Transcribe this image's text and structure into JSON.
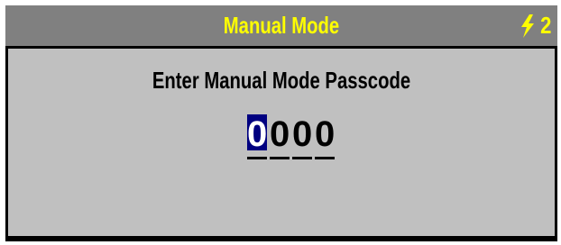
{
  "header": {
    "title": "Manual Mode",
    "status_icon": "lightning-bolt-icon",
    "status_value": "2"
  },
  "main": {
    "prompt": "Enter Manual Mode Passcode",
    "passcode_digits": [
      "0",
      "0",
      "0",
      "0"
    ],
    "active_digit_index": 0
  },
  "colors": {
    "title_bar": "#808080",
    "title_text": "#ffff00",
    "panel": "#c0c0c0",
    "frame": "#000000",
    "highlight": "#000080"
  }
}
